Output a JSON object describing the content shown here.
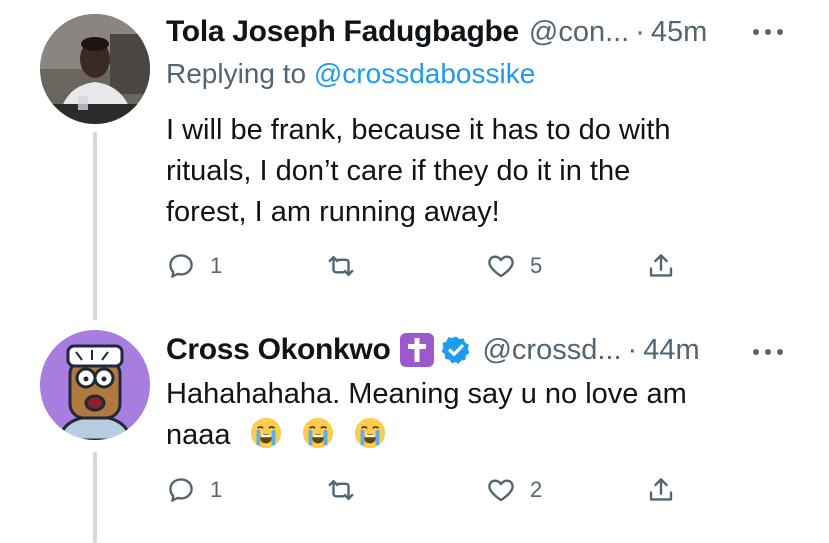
{
  "tweets": [
    {
      "author_name": "Tola Joseph Fadugbagbe",
      "handle": "@con...",
      "separator": "·",
      "time": "45m",
      "replying_label": "Replying to",
      "replying_handle": "@crossdabossike",
      "text_lines": [
        "I will be frank, because it has to do with",
        "rituals, I don’t care if they do it in the",
        "forest, I am running away!"
      ],
      "reply_count": "1",
      "retweet_count": "",
      "like_count": "5",
      "avatar_icon": "profile-photo"
    },
    {
      "author_name": "Cross Okonkwo",
      "badge_icon": "latin-cross-emoji",
      "verified_icon": "verified-badge-icon",
      "handle": "@crossd...",
      "separator": "·",
      "time": "44m",
      "text_line1": "Hahahahaha. Meaning say u no love am",
      "text_line2": "naaa",
      "emojis": [
        "loudly-crying-face",
        "loudly-crying-face",
        "loudly-crying-face"
      ],
      "reply_count": "1",
      "retweet_count": "",
      "like_count": "2",
      "avatar_icon": "cartoon-avatar"
    }
  ],
  "colors": {
    "link": "#1d9bf0",
    "secondary": "#536471",
    "thread_line": "#cfd9de",
    "verified": "#1d9bf0",
    "cross_badge": "#9b59d0",
    "avatar2_bg": "#a77de0"
  }
}
